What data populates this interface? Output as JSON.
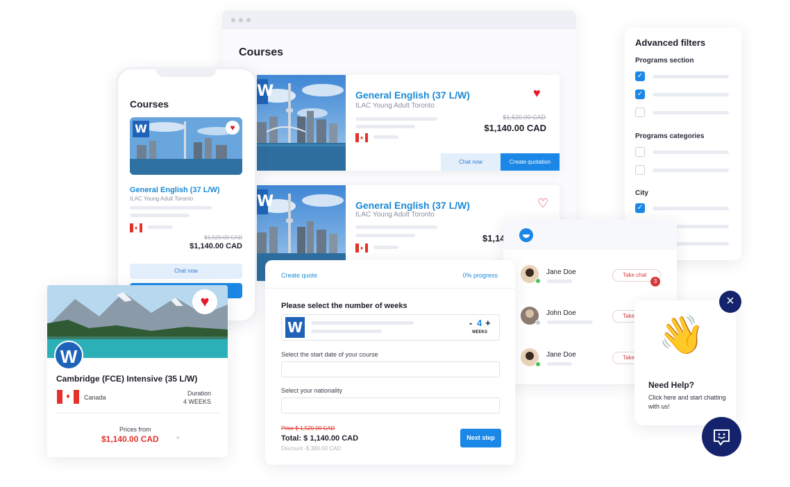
{
  "browser": {
    "title": "Courses"
  },
  "courses": [
    {
      "title": "General English (37 L/W)",
      "school": "ILAC Young Adult Toronto",
      "old_price": "$1,520.00 CAD",
      "price": "$1,140.00 CAD",
      "favorited": true,
      "heart": "♥"
    },
    {
      "title": "General English (37 L/W)",
      "school": "ILAC Young Adult Toronto",
      "old_price": "$1,520.00 CAD",
      "price": "$1,14",
      "favorited": false,
      "heart": "♡"
    }
  ],
  "course_actions": {
    "chat": "Chat now",
    "quote": "Create quotation"
  },
  "phone": {
    "title": "Courses",
    "course": {
      "title": "General English (37 L/W)",
      "school": "ILAC Young Adult Toronto",
      "old_price": "$1,520.00 CAD",
      "price": "$1,140.00 CAD"
    },
    "chat_button": "Chat now",
    "heart": "♥"
  },
  "filters": {
    "title": "Advanced filters",
    "sections": [
      {
        "name": "Programs section",
        "options": [
          true,
          true,
          false
        ]
      },
      {
        "name": "Programs categories",
        "options": [
          false,
          false
        ]
      },
      {
        "name": "City",
        "options": [
          true
        ]
      }
    ]
  },
  "quote": {
    "header_left": "Create quote",
    "progress_label": "0% progress",
    "progress": 0,
    "weeks_question": "Please select the number of weeks",
    "weeks_value": "4",
    "weeks_unit": "WEEKS",
    "minus": "-",
    "plus": "+",
    "start_date_label": "Select the start date of your course",
    "nationality_label": "Select your nationality",
    "old_price": "Price $ 1,520.00 CAD",
    "total": "Total: $ 1,140.00 CAD",
    "discount": "Discount  -$ 380.00 CAD",
    "next_button": "Next step"
  },
  "chat_list": {
    "contacts": [
      {
        "name": "Jane Doe",
        "status": "online",
        "action": "Take chat",
        "badge": "3"
      },
      {
        "name": "John Doe",
        "status": "offline",
        "action": "Take"
      },
      {
        "name": "Jane Doe",
        "status": "online",
        "action": "Take"
      }
    ]
  },
  "help_widget": {
    "close_icon": "×",
    "emoji": "👋",
    "title": "Need Help?",
    "text": "Click here and start chatting with us!",
    "launcher_icon": "chat-bubble-icon"
  },
  "cambridge": {
    "title": "Cambridge (FCE) Intensive (35 L/W)",
    "country": "Canada",
    "duration_label": "Duration",
    "duration_value": "4 WEEKS",
    "prices_from_label": "Prices from",
    "price": "$1,140.00 CAD",
    "heart": "♥"
  },
  "logo_letter": "W",
  "colors": {
    "accent": "#1b87e6",
    "link": "#1a8ad6",
    "navy": "#14236b",
    "red": "#e3322b",
    "online": "#47c25a"
  }
}
